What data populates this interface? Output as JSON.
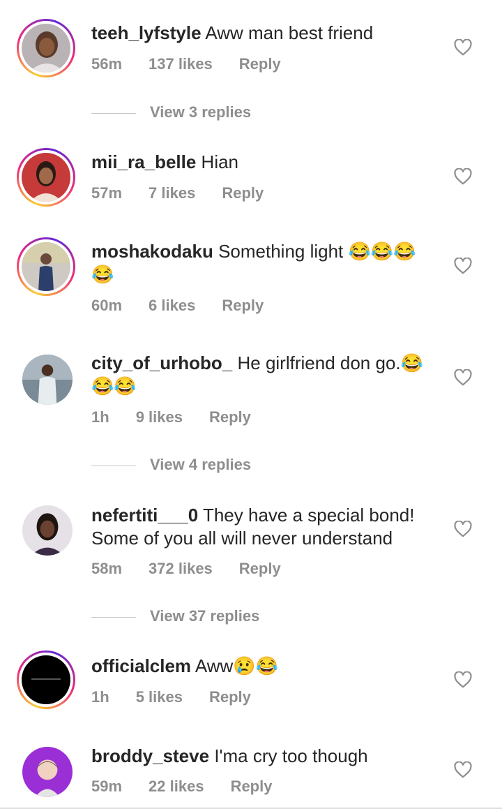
{
  "comments": [
    {
      "user": "teeh_lyfstyle",
      "text": "Aww man best friend",
      "time": "56m",
      "likes": "137 likes",
      "reply": "Reply",
      "view_replies": "View 3 replies"
    },
    {
      "user": "mii_ra_belle",
      "text": "Hian",
      "time": "57m",
      "likes": "7 likes",
      "reply": "Reply"
    },
    {
      "user": "moshakodaku",
      "text": "Something light 😂😂😂",
      "text2": "😂",
      "time": "60m",
      "likes": "6 likes",
      "reply": "Reply"
    },
    {
      "user": "city_of_urhobo_",
      "text": "He girlfriend don go.😂",
      "text2": "😂😂",
      "time": "1h",
      "likes": "9 likes",
      "reply": "Reply",
      "view_replies": "View 4 replies"
    },
    {
      "user": "nefertiti___0",
      "text": "They have a special bond!",
      "text2": "Some of you all will never understand",
      "time": "58m",
      "likes": "372 likes",
      "reply": "Reply",
      "view_replies": "View 37 replies"
    },
    {
      "user": "officialclem",
      "text": "Aww😢😂",
      "time": "1h",
      "likes": "5 likes",
      "reply": "Reply"
    },
    {
      "user": "broddy_steve",
      "text": "I'ma cry too though",
      "time": "59m",
      "likes": "22 likes",
      "reply": "Reply"
    }
  ],
  "icons": {
    "like": "heart-outline-icon"
  },
  "colors": {
    "meta": "#8e8e8e",
    "text": "#262626",
    "ring_start": "#f9ce34",
    "ring_mid": "#ee2a7b",
    "ring_end": "#6228d7"
  }
}
